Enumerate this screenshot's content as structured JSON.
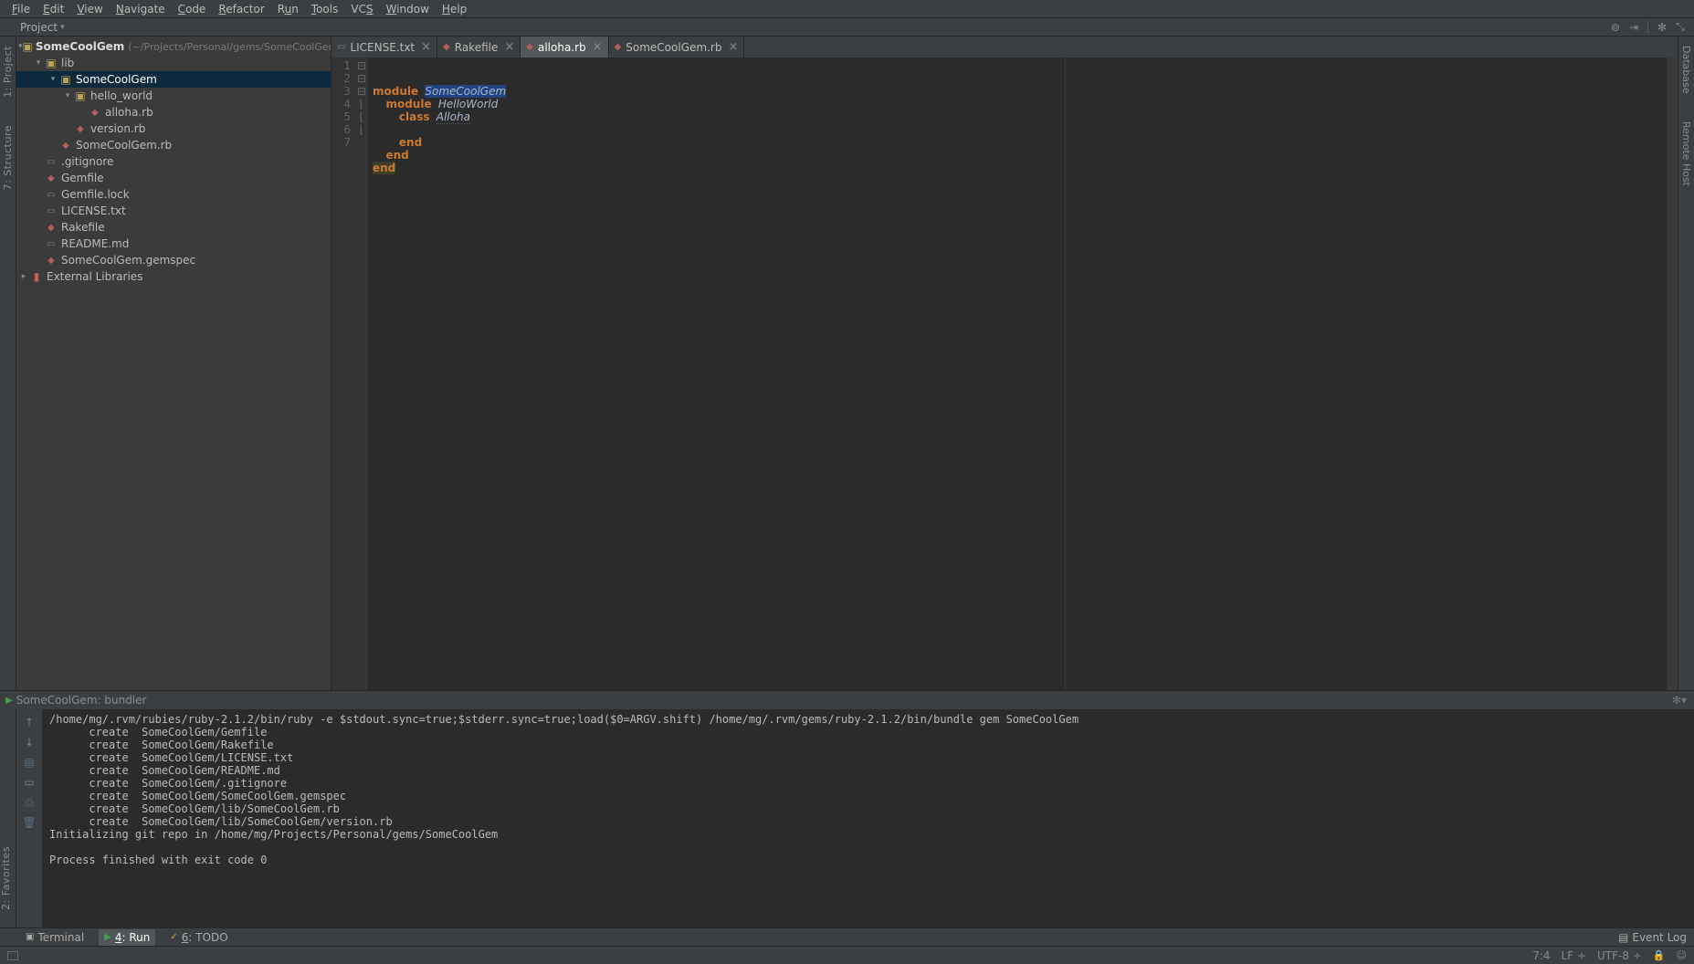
{
  "menu": {
    "items": [
      "File",
      "Edit",
      "View",
      "Navigate",
      "Code",
      "Refactor",
      "Run",
      "Tools",
      "VCS",
      "Window",
      "Help"
    ]
  },
  "toolbar": {
    "label": "Project"
  },
  "left_gutter": {
    "project": "1: Project",
    "structure": "7: Structure"
  },
  "right_gutter": {
    "database": "Database",
    "remote": "Remote Host"
  },
  "project": {
    "root": {
      "name": "SomeCoolGem",
      "path": "(~/Projects/Personal/gems/SomeCoolGem)"
    },
    "tree": [
      {
        "name": "lib",
        "type": "folder",
        "indent": 1,
        "arrow": "▾"
      },
      {
        "name": "SomeCoolGem",
        "type": "folder",
        "indent": 2,
        "arrow": "▾",
        "selected": true
      },
      {
        "name": "hello_world",
        "type": "folder",
        "indent": 3,
        "arrow": "▾"
      },
      {
        "name": "alloha.rb",
        "type": "ruby",
        "indent": 4
      },
      {
        "name": "version.rb",
        "type": "ruby",
        "indent": 3
      },
      {
        "name": "SomeCoolGem.rb",
        "type": "ruby",
        "indent": 2
      },
      {
        "name": ".gitignore",
        "type": "txt",
        "indent": 1
      },
      {
        "name": "Gemfile",
        "type": "ruby",
        "indent": 1
      },
      {
        "name": "Gemfile.lock",
        "type": "txt",
        "indent": 1
      },
      {
        "name": "LICENSE.txt",
        "type": "txt",
        "indent": 1
      },
      {
        "name": "Rakefile",
        "type": "ruby",
        "indent": 1
      },
      {
        "name": "README.md",
        "type": "txt",
        "indent": 1
      },
      {
        "name": "SomeCoolGem.gemspec",
        "type": "ruby",
        "indent": 1
      }
    ],
    "external": "External Libraries"
  },
  "tabs": [
    {
      "name": "LICENSE.txt",
      "icon": "txt",
      "close": true
    },
    {
      "name": "Rakefile",
      "icon": "ruby",
      "close": true
    },
    {
      "name": "alloha.rb",
      "icon": "ruby",
      "close": true,
      "active": true
    },
    {
      "name": "SomeCoolGem.rb",
      "icon": "ruby",
      "close": true
    }
  ],
  "editor": {
    "lines": [
      "1",
      "2",
      "3",
      "4",
      "5",
      "6",
      "7"
    ],
    "code": {
      "l1": {
        "kw": "module",
        "cls": "SomeCoolGem"
      },
      "l2": {
        "kw": "module",
        "cls": "HelloWorld"
      },
      "l3": {
        "kw": "class",
        "cls": "Alloha"
      },
      "l5": "end",
      "l6": "end",
      "l7": "end"
    }
  },
  "console": {
    "title": "SomeCoolGem: bundler",
    "cmd": "/home/mg/.rvm/rubies/ruby-2.1.2/bin/ruby -e $stdout.sync=true;$stderr.sync=true;load($0=ARGV.shift) /home/mg/.rvm/gems/ruby-2.1.2/bin/bundle gem SomeCoolGem",
    "lines": [
      "      create  SomeCoolGem/Gemfile",
      "      create  SomeCoolGem/Rakefile",
      "      create  SomeCoolGem/LICENSE.txt",
      "      create  SomeCoolGem/README.md",
      "      create  SomeCoolGem/.gitignore",
      "      create  SomeCoolGem/SomeCoolGem.gemspec",
      "      create  SomeCoolGem/lib/SomeCoolGem.rb",
      "      create  SomeCoolGem/lib/SomeCoolGem/version.rb",
      "Initializing git repo in /home/mg/Projects/Personal/gems/SomeCoolGem",
      "",
      "Process finished with exit code 0"
    ]
  },
  "bottom_tabs": {
    "terminal": "Terminal",
    "run": "4: Run",
    "todo": "6: TODO",
    "event_log": "Event Log"
  },
  "favorites": "2: Favorites",
  "status": {
    "pos": "7:4",
    "eol": "LF",
    "enc": "UTF-8"
  }
}
